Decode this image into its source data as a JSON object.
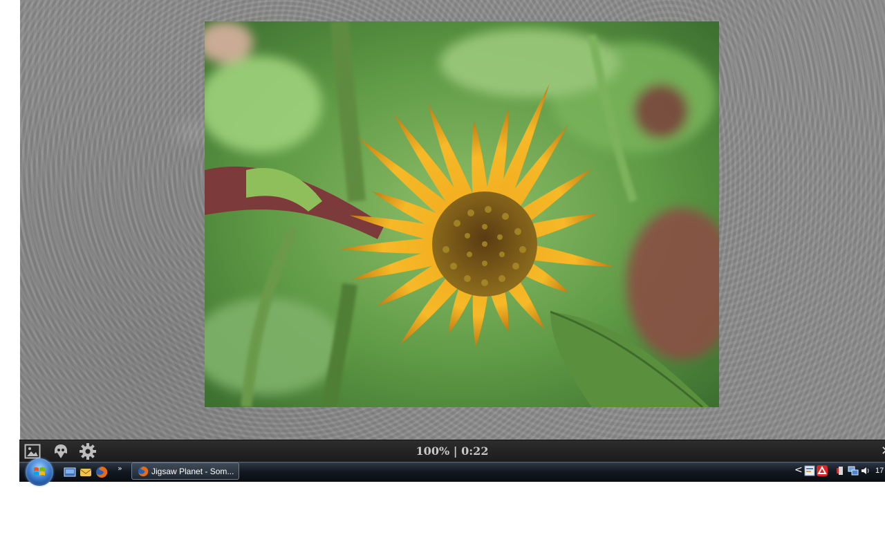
{
  "toolbar": {
    "status_percent": "100%",
    "status_separator": "|",
    "status_time": "0:22",
    "icons": [
      "image-icon",
      "ghost-icon",
      "gear-icon"
    ]
  },
  "taskbar": {
    "task_button_label": "Jigsaw Planet - Som...",
    "quick_launch_more": "»",
    "tray_chevron": "<",
    "clock": "17"
  },
  "colors": {
    "toolbar_bg": "#1f1f1f",
    "status_text": "#c9c9c9",
    "game_bg": "#8d8d8d"
  }
}
